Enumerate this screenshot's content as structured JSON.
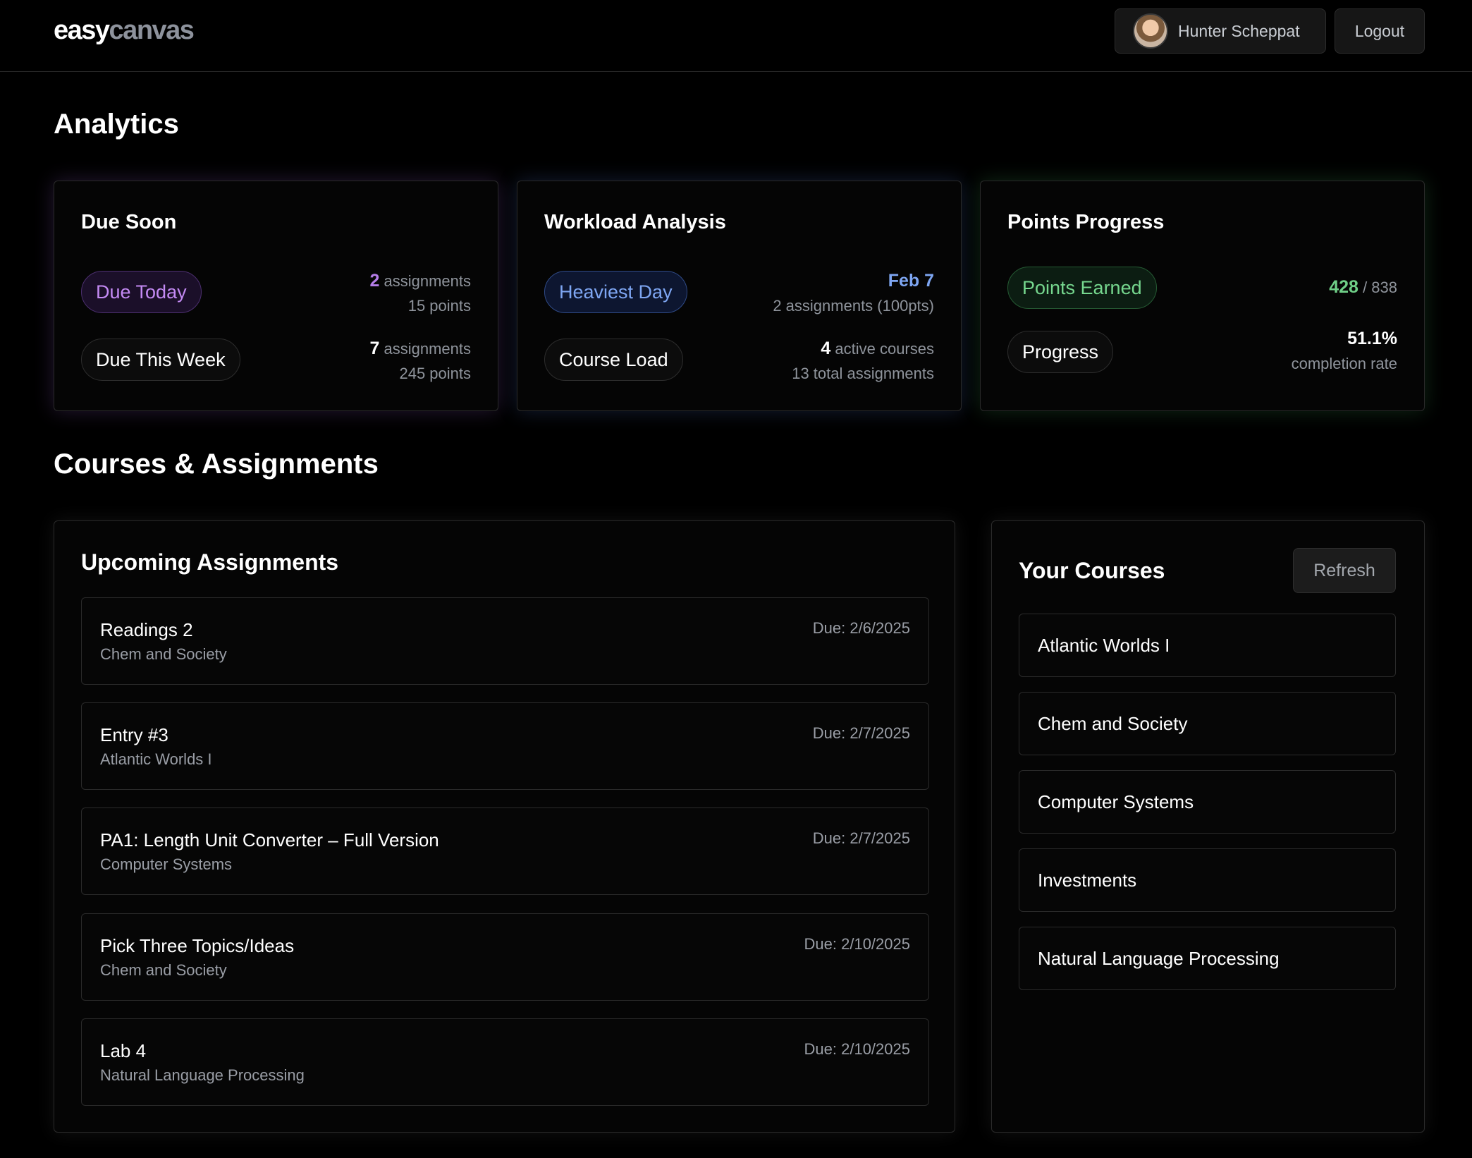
{
  "header": {
    "logo_part1": "easy",
    "logo_part2": "canvas",
    "user_name": "Hunter Scheppat",
    "logout_label": "Logout"
  },
  "analytics": {
    "title": "Analytics",
    "due_soon": {
      "title": "Due Soon",
      "today_label": "Due Today",
      "today_count": "2",
      "today_count_unit": "assignments",
      "today_points": "15 points",
      "week_label": "Due This Week",
      "week_count": "7",
      "week_count_unit": "assignments",
      "week_points": "245 points"
    },
    "workload": {
      "title": "Workload Analysis",
      "heaviest_label": "Heaviest Day",
      "heaviest_date": "Feb 7",
      "heaviest_detail": "2 assignments (100pts)",
      "load_label": "Course Load",
      "active_count": "4",
      "active_unit": "active courses",
      "total_assignments": "13 total assignments"
    },
    "points": {
      "title": "Points Progress",
      "earned_label": "Points Earned",
      "earned": "428",
      "total": "/ 838",
      "progress_label": "Progress",
      "rate": "51.1%",
      "rate_unit": "completion rate"
    }
  },
  "courses_section": {
    "title": "Courses & Assignments",
    "upcoming": {
      "title": "Upcoming Assignments",
      "items": [
        {
          "name": "Readings 2",
          "course": "Chem and Society",
          "due": "Due: 2/6/2025"
        },
        {
          "name": "Entry #3",
          "course": "Atlantic Worlds I",
          "due": "Due: 2/7/2025"
        },
        {
          "name": "PA1: Length Unit Converter – Full Version",
          "course": "Computer Systems",
          "due": "Due: 2/7/2025"
        },
        {
          "name": "Pick Three Topics/Ideas",
          "course": "Chem and Society",
          "due": "Due: 2/10/2025"
        },
        {
          "name": "Lab 4",
          "course": "Natural Language Processing",
          "due": "Due: 2/10/2025"
        }
      ]
    },
    "your_courses": {
      "title": "Your Courses",
      "refresh_label": "Refresh",
      "items": [
        "Atlantic Worlds I",
        "Chem and Society",
        "Computer Systems",
        "Investments",
        "Natural Language Processing"
      ]
    }
  },
  "colors": {
    "accent_purple": "#b57de8",
    "accent_blue": "#7ea6f2",
    "accent_green": "#6fcf87",
    "background": "#000000"
  }
}
